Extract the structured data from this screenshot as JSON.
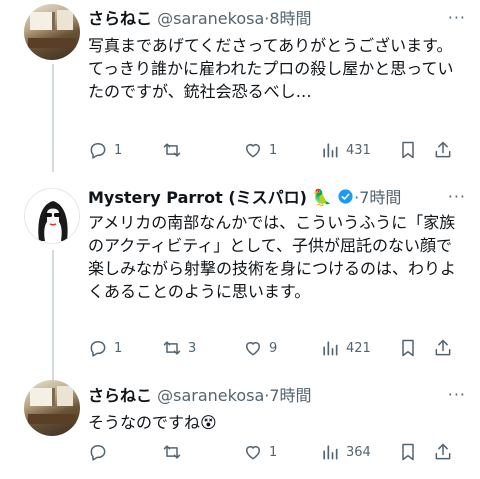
{
  "tweets": [
    {
      "name": "さらねこ",
      "handle": "@saranekosa",
      "sep": "·",
      "time": "8時間",
      "text": "写真まであげてくださってありがとうございます。\nてっきり誰かに雇われたプロの殺し屋かと思っていたのですが、銃社会恐るべし…",
      "replies": "1",
      "retweets": "",
      "likes": "1",
      "views": "431"
    },
    {
      "name": "Mystery Parrot (ミスパロ)",
      "handle": "",
      "sep": "·",
      "time": "7時間",
      "text": "アメリカの南部なんかでは、こういうふうに「家族のアクティビティ」として、子供が屈託のない顔で楽しみながら射撃の技術を身につけるのは、わりよくあることのように思います。",
      "replies": "1",
      "retweets": "3",
      "likes": "9",
      "views": "421"
    },
    {
      "name": "さらねこ",
      "handle": "@saranekosa",
      "sep": "·",
      "time": "7時間",
      "text": "そうなのですね😵",
      "replies": "",
      "retweets": "",
      "likes": "1",
      "views": "364"
    }
  ],
  "colors": {
    "text": "#0f1419",
    "muted": "#536471",
    "verified": "#1d9bf0",
    "line": "#cfd9de"
  },
  "icons": [
    "reply-icon",
    "retweet-icon",
    "like-icon",
    "views-icon",
    "bookmark-icon",
    "share-icon",
    "verified-badge-icon",
    "parrot-emoji-icon",
    "more-icon"
  ]
}
